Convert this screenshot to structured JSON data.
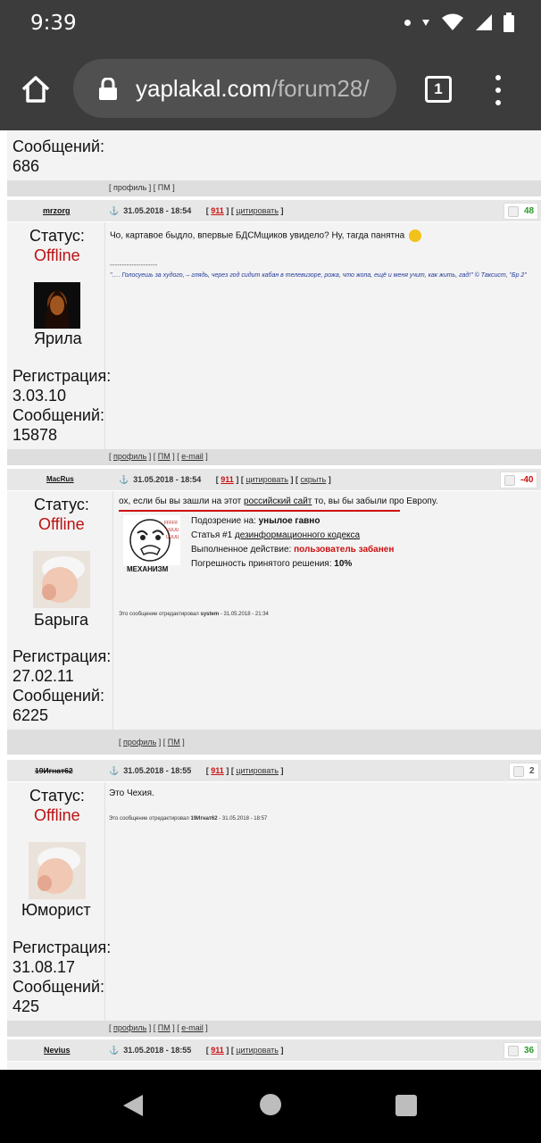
{
  "status_bar": {
    "time": "9:39"
  },
  "browser": {
    "url_host": "yaplakal.com",
    "url_path": "/forum28/",
    "tab_count": "1"
  },
  "top_fragment": {
    "count_label": "Сообщений:",
    "count_value": "686",
    "links": "[ профиль ] [ ПМ ]"
  },
  "posts": [
    {
      "nick": "mrzorg",
      "date": "31.05.2018 - 18:54",
      "num": "911",
      "quote": "цитировать",
      "rating": "48",
      "status_label": "Статус:",
      "status_value": "Offline",
      "rank": "Ярила",
      "reg_label": "Регистрация:",
      "reg_value": "3.03.10",
      "msgs_label": "Сообщений:",
      "msgs_value": "15878",
      "text": "Чо, картавое быдло, впервые БДСМщиков увидело? Ну, тагда панятна",
      "sig_sep": "--------------------",
      "signature": "\"…. Голосуешь за худого, – глядь, через год сидит кабан в телевизоре, рожа, что жопа, ещё и меня учит, как жить, гад!\" © Таксист, \"Бр 2\"",
      "footer": {
        "profile": "профиль",
        "pm": "ПМ",
        "email": "e-mail"
      }
    },
    {
      "nick": "MacRus",
      "date": "31.05.2018 - 18:54",
      "num": "911",
      "quote": "цитировать",
      "hide": "скрыть",
      "rating": "-40",
      "status_label": "Статус:",
      "status_value": "Offline",
      "rank": "Барыга",
      "reg_label": "Регистрация:",
      "reg_value": "27.02.11",
      "msgs_label": "Сообщений:",
      "msgs_value": "6225",
      "text_pre": "ох, если бы вы зашли на этот ",
      "text_link": "российский сайт",
      "text_post": " то, вы бы забыли про Европу.",
      "ban": {
        "image_caption": "МЕХАНИЗМ",
        "suspicion_label": "Подозрение на:",
        "suspicion_value": "унылое гавно",
        "article_pre": "Статья #1 ",
        "article_link": "дезинформационного кодекса",
        "action_label": "Выполненное действие:",
        "action_value": "пользователь забанен",
        "error_label": "Погрешность принятого решения:",
        "error_value": "10%"
      },
      "edited_pre": "Это сообщение отредактировал ",
      "edited_by": "system",
      "edited_date": " - 31.05.2018 - 21:34",
      "footer": {
        "profile": "профиль",
        "pm": "ПМ"
      }
    },
    {
      "nick": "19Игнат62",
      "date": "31.05.2018 - 18:55",
      "num": "911",
      "quote": "цитировать",
      "rating": "2",
      "status_label": "Статус:",
      "status_value": "Offline",
      "rank": "Юморист",
      "reg_label": "Регистрация:",
      "reg_value": "31.08.17",
      "msgs_label": "Сообщений:",
      "msgs_value": "425",
      "text": "Это Чехия.",
      "edited_pre": "Это сообщение отредактировал ",
      "edited_by": "19Игнат62",
      "edited_date": " - 31.05.2018 - 18:57",
      "footer": {
        "profile": "профиль",
        "pm": "ПМ",
        "email": "e-mail"
      }
    },
    {
      "nick": "Nevius",
      "date": "31.05.2018 - 18:55",
      "num": "911",
      "quote": "цитировать",
      "rating": "36"
    }
  ]
}
